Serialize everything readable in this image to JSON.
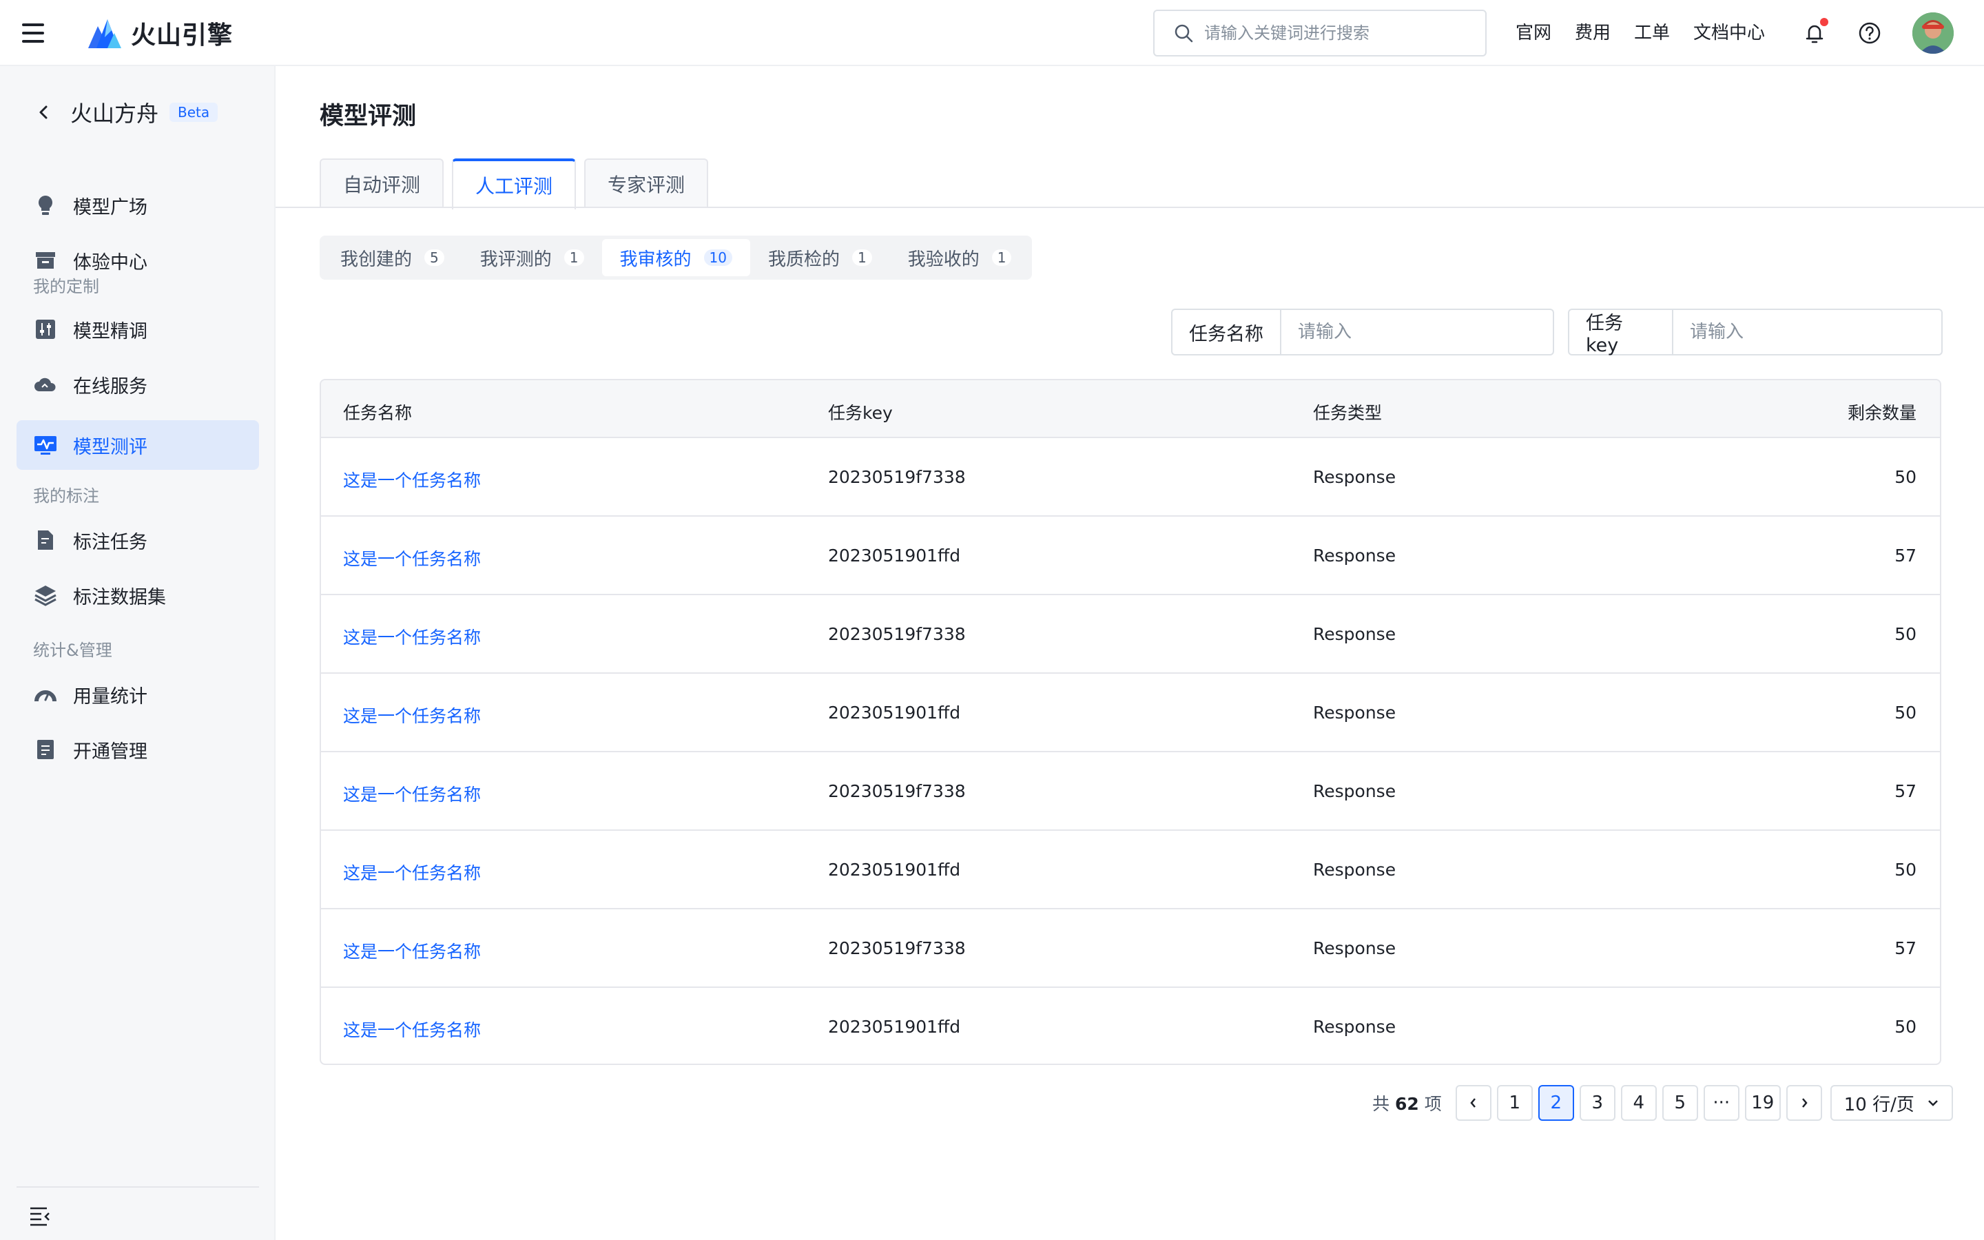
{
  "header": {
    "brand": "火山引擎",
    "search_placeholder": "请输入关键词进行搜索",
    "links": [
      "官网",
      "费用",
      "工单",
      "文档中心"
    ],
    "accent": "#1664ff"
  },
  "sidebar": {
    "title": "火山方舟",
    "badge": "Beta",
    "items": [
      {
        "label": "模型广场",
        "icon": "lightbulb-icon"
      },
      {
        "label": "体验中心",
        "icon": "archive-box-icon"
      },
      {
        "label": "模型精调",
        "icon": "tune-icon"
      },
      {
        "label": "在线服务",
        "icon": "cloud-icon"
      },
      {
        "label": "模型测评",
        "icon": "monitor-pulse-icon"
      },
      {
        "label": "标注任务",
        "icon": "document-edit-icon"
      },
      {
        "label": "标注数据集",
        "icon": "layers-icon"
      },
      {
        "label": "用量统计",
        "icon": "gauge-icon"
      },
      {
        "label": "开通管理",
        "icon": "clipboard-icon"
      }
    ],
    "groups": [
      "我的定制",
      "我的标注",
      "统计&管理"
    ],
    "active_item": "模型测评"
  },
  "main": {
    "title": "模型评测",
    "tabs": [
      "自动评测",
      "人工评测",
      "专家评测"
    ],
    "active_tab": "人工评测",
    "segments": [
      {
        "label": "我创建的",
        "count": "5"
      },
      {
        "label": "我评测的",
        "count": "1"
      },
      {
        "label": "我审核的",
        "count": "10"
      },
      {
        "label": "我质检的",
        "count": "1"
      },
      {
        "label": "我验收的",
        "count": "1"
      }
    ],
    "active_segment": "我审核的",
    "filters": [
      {
        "label": "任务名称",
        "placeholder": "请输入"
      },
      {
        "label": "任务key",
        "placeholder": "请输入"
      }
    ],
    "table": {
      "columns": [
        "任务名称",
        "任务key",
        "任务类型",
        "剩余数量"
      ],
      "rows": [
        [
          "这是一个任务名称",
          "20230519f7338",
          "Response",
          "50"
        ],
        [
          "这是一个任务名称",
          "2023051901ffd",
          "Response",
          "57"
        ],
        [
          "这是一个任务名称",
          "20230519f7338",
          "Response",
          "50"
        ],
        [
          "这是一个任务名称",
          "2023051901ffd",
          "Response",
          "50"
        ],
        [
          "这是一个任务名称",
          "20230519f7338",
          "Response",
          "57"
        ],
        [
          "这是一个任务名称",
          "2023051901ffd",
          "Response",
          "50"
        ],
        [
          "这是一个任务名称",
          "20230519f7338",
          "Response",
          "57"
        ],
        [
          "这是一个任务名称",
          "2023051901ffd",
          "Response",
          "50"
        ]
      ]
    },
    "pagination": {
      "total_prefix": "共",
      "total": "62",
      "total_suffix": "项",
      "pages": [
        "1",
        "2",
        "3",
        "4",
        "5",
        "···",
        "19"
      ],
      "current": "2",
      "page_size": "10 行/页"
    }
  }
}
